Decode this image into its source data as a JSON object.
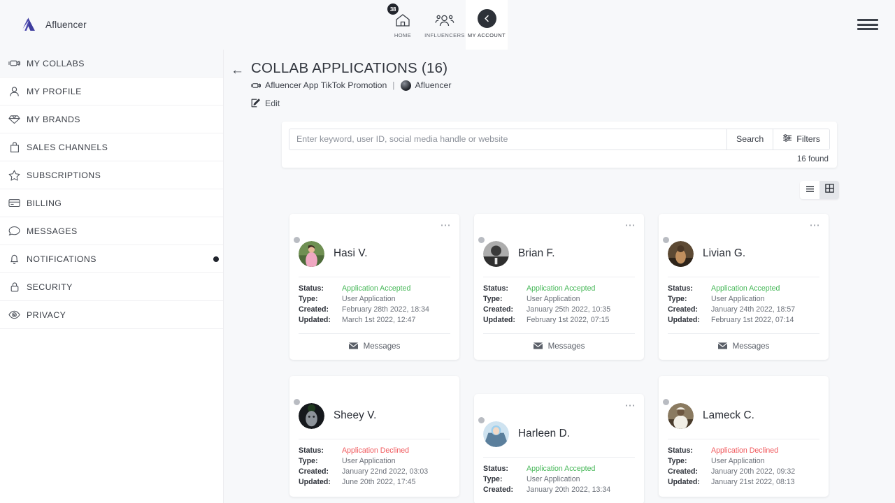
{
  "brand": {
    "name": "Afluencer",
    "logo_color": "#3f3d9e"
  },
  "topnav": {
    "items": [
      {
        "label": "HOME",
        "icon": "home-icon",
        "badge": "38",
        "active": false
      },
      {
        "label": "INFLUENCERS",
        "icon": "people-icon",
        "badge": "",
        "active": false
      },
      {
        "label": "MY ACCOUNT",
        "icon": "back-circle-icon",
        "badge": "",
        "active": true
      }
    ]
  },
  "sidebar": {
    "items": [
      {
        "label": "MY COLLABS",
        "icon": "collabs-icon",
        "active": true,
        "dot": false
      },
      {
        "label": "MY PROFILE",
        "icon": "user-icon",
        "active": false,
        "dot": false
      },
      {
        "label": "MY BRANDS",
        "icon": "diamond-icon",
        "active": false,
        "dot": false
      },
      {
        "label": "SALES CHANNELS",
        "icon": "bag-icon",
        "active": false,
        "dot": false
      },
      {
        "label": "SUBSCRIPTIONS",
        "icon": "star-icon",
        "active": false,
        "dot": false
      },
      {
        "label": "BILLING",
        "icon": "credit-card-icon",
        "active": false,
        "dot": false
      },
      {
        "label": "MESSAGES",
        "icon": "chat-bubble-icon",
        "active": false,
        "dot": false
      },
      {
        "label": "NOTIFICATIONS",
        "icon": "bell-icon",
        "active": false,
        "dot": true
      },
      {
        "label": "SECURITY",
        "icon": "lock-icon",
        "active": false,
        "dot": false
      },
      {
        "label": "PRIVACY",
        "icon": "eye-icon",
        "active": false,
        "dot": false
      }
    ]
  },
  "header": {
    "back_icon": "arrow-left-icon",
    "title": "COLLAB APPLICATIONS (16)",
    "breadcrumb_icon": "collabs-icon",
    "breadcrumb_collab": "Afluencer App TikTok Promotion",
    "breadcrumb_separator": "|",
    "breadcrumb_brand": "Afluencer",
    "edit_icon": "edit-icon",
    "edit_label": "Edit"
  },
  "search": {
    "placeholder": "Enter keyword, user ID, social media handle or website",
    "value": "",
    "search_label": "Search",
    "filters_label": "Filters",
    "filters_icon": "sliders-icon",
    "found_label": "16 found"
  },
  "view_toggle": {
    "list_icon": "list-view-icon",
    "grid_icon": "grid-view-icon",
    "active": "grid"
  },
  "cards_labels": {
    "status": "Status:",
    "type": "Type:",
    "created": "Created:",
    "updated": "Updated:",
    "messages": "Messages",
    "messages_icon": "envelope-icon",
    "menu_icon": "more-horizontal-icon"
  },
  "status_colors": {
    "accepted": "#45b757",
    "declined": "#f0585c"
  },
  "cards": [
    {
      "name": "Hasi V.",
      "status": "Application Accepted",
      "status_kind": "accepted",
      "type": "User Application",
      "created": "February 28th 2022, 18:34",
      "updated": "March 1st 2022, 12:47",
      "has_menu": true,
      "has_footer": true,
      "shift": false,
      "avatar_colors": [
        "#7fa05a",
        "#e78fb0",
        "#f2c7d6"
      ]
    },
    {
      "name": "Brian F.",
      "status": "Application Accepted",
      "status_kind": "accepted",
      "type": "User Application",
      "created": "January 25th 2022, 10:35",
      "updated": "February 1st 2022, 07:15",
      "has_menu": true,
      "has_footer": true,
      "shift": false,
      "avatar_colors": [
        "#9a9a9a",
        "#3c3c3c",
        "#d8d8d8"
      ]
    },
    {
      "name": "Livian G.",
      "status": "Application Accepted",
      "status_kind": "accepted",
      "type": "User Application",
      "created": "January 24th 2022, 18:57",
      "updated": "February 1st 2022, 07:14",
      "has_menu": true,
      "has_footer": true,
      "shift": false,
      "avatar_colors": [
        "#6b5640",
        "#3b2d1f",
        "#c49a6c"
      ]
    },
    {
      "name": "Sheey V.",
      "status": "Application Declined",
      "status_kind": "declined",
      "type": "User Application",
      "created": "January 22nd 2022, 03:03",
      "updated": "June 20th 2022, 17:45",
      "has_menu": false,
      "has_footer": false,
      "shift": false,
      "avatar_colors": [
        "#1d1f22",
        "#6f7479",
        "#0e1012"
      ]
    },
    {
      "name": "Harleen D.",
      "status": "Application Accepted",
      "status_kind": "accepted",
      "type": "User Application",
      "created": "January 20th 2022, 13:34",
      "updated": "",
      "has_menu": true,
      "has_footer": false,
      "shift": true,
      "avatar_colors": [
        "#8ec7e8",
        "#d9e9f4",
        "#4a6f8a"
      ]
    },
    {
      "name": "Lameck C.",
      "status": "Application Declined",
      "status_kind": "declined",
      "type": "User Application",
      "created": "January 20th 2022, 09:32",
      "updated": "January 21st 2022, 08:13",
      "has_menu": false,
      "has_footer": false,
      "shift": false,
      "avatar_colors": [
        "#7a6a52",
        "#e8e4da",
        "#45382a"
      ]
    }
  ]
}
